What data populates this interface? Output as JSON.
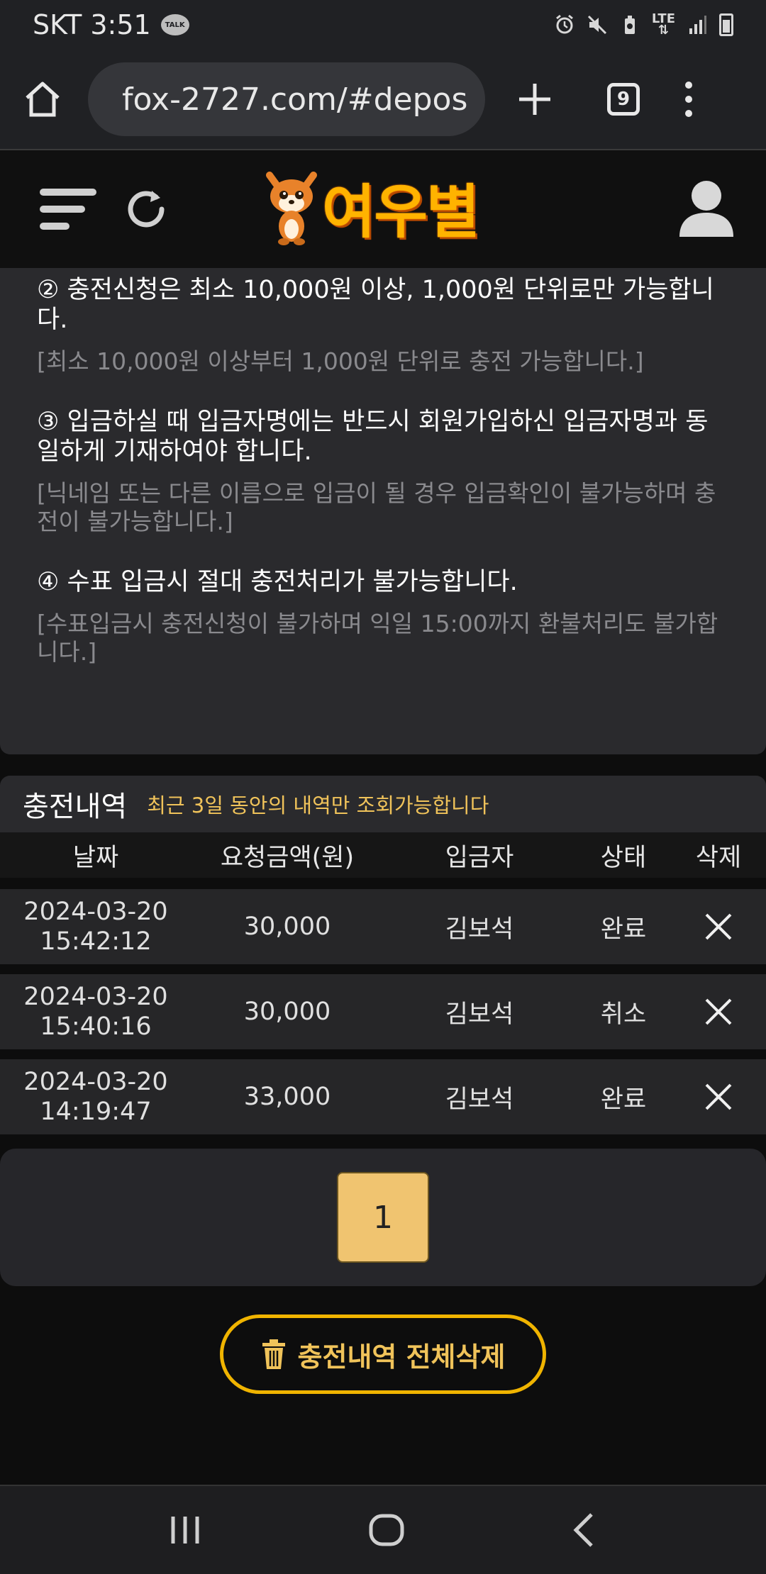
{
  "status_bar": {
    "carrier_time": "SKT 3:51",
    "talk_badge": "TALK",
    "network": "LTE"
  },
  "browser": {
    "url": "fox-2727.com/#depos",
    "tab_count": "9"
  },
  "site": {
    "logo_text": "여우별"
  },
  "notices": [
    {
      "main": "② 충전신청은 최소 10,000원 이상, 1,000원 단위로만 가능합니다.",
      "sub": "[최소 10,000원 이상부터 1,000원 단위로 충전 가능합니다.]"
    },
    {
      "main": "③ 입금하실 때 입금자명에는 반드시 회원가입하신 입금자명과 동일하게 기재하여야 합니다.",
      "sub": "[닉네임 또는 다른 이름으로 입금이 될 경우 입금확인이 불가능하며 충전이 불가능합니다.]"
    },
    {
      "main": "④ 수표 입금시 절대 충전처리가 불가능합니다.",
      "sub": "[수표입금시 충전신청이 불가하며 익일 15:00까지 환불처리도 불가합니다.]"
    }
  ],
  "history": {
    "title": "충전내역",
    "note": "최근 3일 동안의 내역만 조회가능합니다",
    "columns": [
      "날짜",
      "요청금액(원)",
      "입금자",
      "상태",
      "삭제"
    ],
    "rows": [
      {
        "date": "2024-03-20",
        "time": "15:42:12",
        "amount": "30,000",
        "depositor": "김보석",
        "status": "완료"
      },
      {
        "date": "2024-03-20",
        "time": "15:40:16",
        "amount": "30,000",
        "depositor": "김보석",
        "status": "취소"
      },
      {
        "date": "2024-03-20",
        "time": "14:19:47",
        "amount": "33,000",
        "depositor": "김보석",
        "status": "완료"
      }
    ]
  },
  "pagination": {
    "current_page": "1"
  },
  "delete_all": {
    "label": "충전내역 전체삭제"
  },
  "colors": {
    "accent": "#f0c35a",
    "page_button": "#f0c470",
    "delete_border": "#f0b400",
    "panel": "#2a2a2d"
  },
  "icons": [
    "talk-icon",
    "alarm-icon",
    "mute-icon",
    "battery-saver-icon",
    "signal-icon",
    "battery-icon",
    "home-icon",
    "site-info-icon",
    "new-tab-icon",
    "tab-switcher-icon",
    "more-icon",
    "menu-icon",
    "refresh-icon",
    "user-icon",
    "close-icon",
    "trash-icon",
    "recent-apps-icon",
    "home-nav-icon",
    "back-icon"
  ]
}
